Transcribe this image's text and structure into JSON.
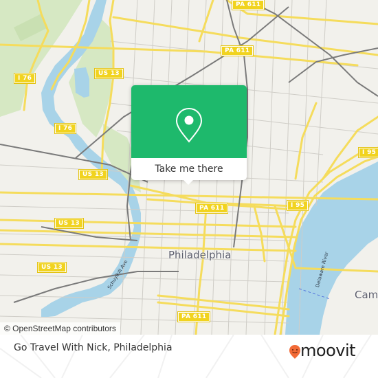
{
  "map": {
    "city_label": "Philadelphia",
    "partial_city_label": "Cam",
    "river_label": "Delaware River",
    "street_label": "Schuylkill Ave",
    "road_shields": [
      {
        "id": "i76-north",
        "label": "I 76"
      },
      {
        "id": "i76-south",
        "label": "I 76"
      },
      {
        "id": "us13-north",
        "label": "US 13"
      },
      {
        "id": "us13-mid",
        "label": "US 13"
      },
      {
        "id": "us13-west",
        "label": "US 13"
      },
      {
        "id": "us13-southwest",
        "label": "US 13"
      },
      {
        "id": "pa611-top",
        "label": "PA 611"
      },
      {
        "id": "pa611-north",
        "label": "PA 611"
      },
      {
        "id": "pa611-center",
        "label": "PA 611"
      },
      {
        "id": "pa611-south",
        "label": "PA 611"
      },
      {
        "id": "i95-north",
        "label": "I 95"
      },
      {
        "id": "i95-center",
        "label": "I 95"
      }
    ],
    "attribution": "© OpenStreetMap contributors",
    "colors": {
      "land": "#f2f1ec",
      "park": "#d6e8c3",
      "water": "#a8d3e8",
      "major_road": "#f5dc5c",
      "minor_road": "#c9c7c2",
      "rail": "#7a7a7a",
      "shield": "#f1d31f"
    }
  },
  "popup": {
    "icon": "map-pin-icon",
    "button_label": "Take me there",
    "accent_color": "#1eb96c"
  },
  "footer": {
    "place_title": "Go Travel With Nick, Philadelphia",
    "brand_name": "moovit",
    "brand_color": "#f26a36"
  }
}
